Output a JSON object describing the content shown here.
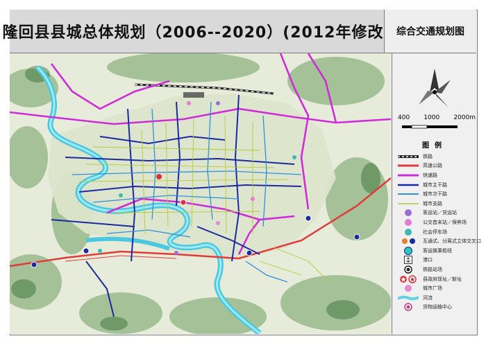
{
  "header": {
    "title": "隆回县县城总体规划（2006--2020）(2012年修改)",
    "subtitle": "综合交通规划图"
  },
  "scale": {
    "ticks": [
      "400",
      "1000",
      "2000m"
    ]
  },
  "legend": {
    "title": "图例",
    "items": [
      {
        "label": "铁路",
        "icon": "railway-line"
      },
      {
        "label": "高速公路",
        "icon": "expressway-line",
        "color": "#e23a3a"
      },
      {
        "label": "快速路",
        "icon": "fast-road-line",
        "color": "#d02bd8"
      },
      {
        "label": "城市主干路",
        "icon": "arterial-line",
        "color": "#1a2a9e"
      },
      {
        "label": "城市次干路",
        "icon": "secondary-road-line",
        "color": "#2f8fd9"
      },
      {
        "label": "城市支路",
        "icon": "branch-road-line",
        "color": "#b6c93a"
      },
      {
        "label": "客运站／货运站",
        "icon": "station-poi",
        "color": "#9a6fd4"
      },
      {
        "label": "公交首末站／保养场",
        "icon": "bus-terminal-poi",
        "color": "#e47ad3"
      },
      {
        "label": "社会停车场",
        "icon": "parking-poi",
        "color": "#3fb8b1"
      },
      {
        "label": "互通式、分离式立体交叉口",
        "icon": "interchange-poi",
        "color": "#e77f2a"
      },
      {
        "label": "客运换乘枢纽",
        "icon": "transfer-hub-poi",
        "color": "#2ec4b6"
      },
      {
        "label": "港口",
        "icon": "port-icon"
      },
      {
        "label": "铁路站场",
        "icon": "rail-station-icon"
      },
      {
        "label": "县政府现址／新址",
        "icon": "government-icon",
        "color": "#d8323a"
      },
      {
        "label": "城市广场",
        "icon": "plaza-poi",
        "color": "#e58ad0"
      },
      {
        "label": "河流",
        "icon": "river-icon",
        "color": "#5fd3e6"
      },
      {
        "label": "货物运输中心",
        "icon": "freight-center-icon",
        "color": "#c23a7a"
      }
    ]
  }
}
